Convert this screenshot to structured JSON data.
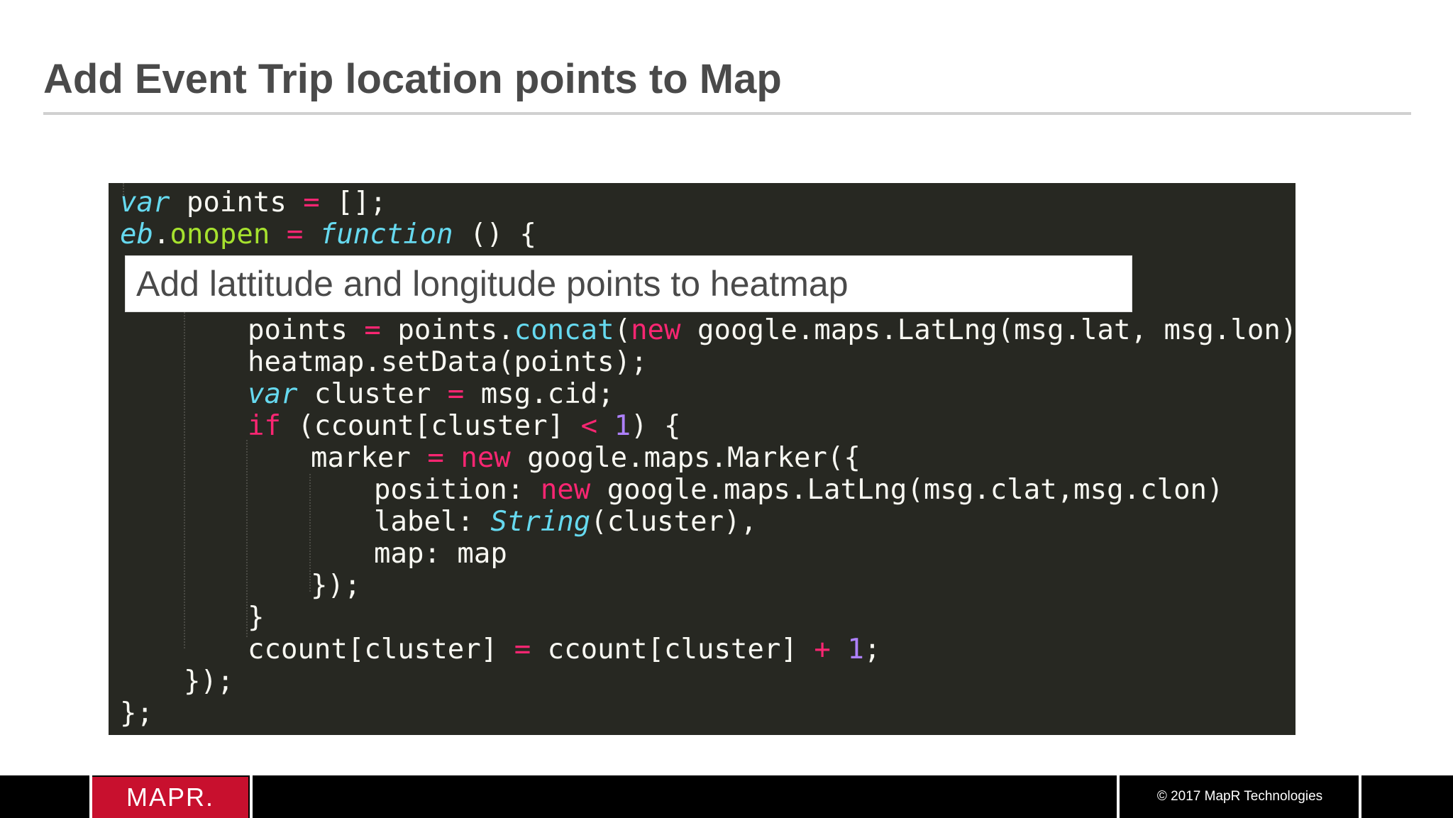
{
  "slide": {
    "title": "Add Event Trip location points to Map",
    "callout": "Add lattitude and longitude points to heatmap"
  },
  "code": {
    "language": "javascript",
    "lines": [
      "var points = [];",
      "eb.onopen = function () {",
      "        points = points.concat(new google.maps.LatLng(msg.lat, msg.lon));",
      "        heatmap.setData(points);",
      "        var cluster = msg.cid;",
      "        if (ccount[cluster] < 1) {",
      "            marker = new google.maps.Marker({",
      "                position: new google.maps.LatLng(msg.clat,msg.clon)",
      "                label: String(cluster),",
      "                map: map",
      "            });",
      "        }",
      "        ccount[cluster] = ccount[cluster] + 1;",
      "    });",
      "};"
    ]
  },
  "footer": {
    "logo": "MAPR.",
    "copyright": "© 2017 MapR Technologies"
  },
  "colors": {
    "title": "#4a4a4a",
    "code_background": "#272822",
    "brand_red": "#c8102e",
    "footer_background": "#000000"
  }
}
